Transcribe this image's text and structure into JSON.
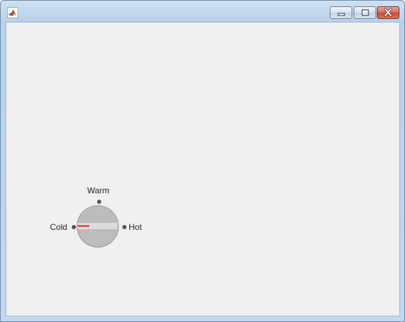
{
  "window": {
    "title": "",
    "icon": "matlab-logo-icon",
    "controls": [
      "minimize",
      "maximize",
      "close"
    ]
  },
  "knob": {
    "states": {
      "left": "Cold",
      "top": "Warm",
      "right": "Hot"
    },
    "selected": "Cold",
    "indicator_color": "#e02020"
  },
  "colors": {
    "client_bg": "#f0f0f0",
    "knob_body": "#bdbdbd",
    "knob_bar": "#dcdcdc",
    "tick": "#555555"
  }
}
